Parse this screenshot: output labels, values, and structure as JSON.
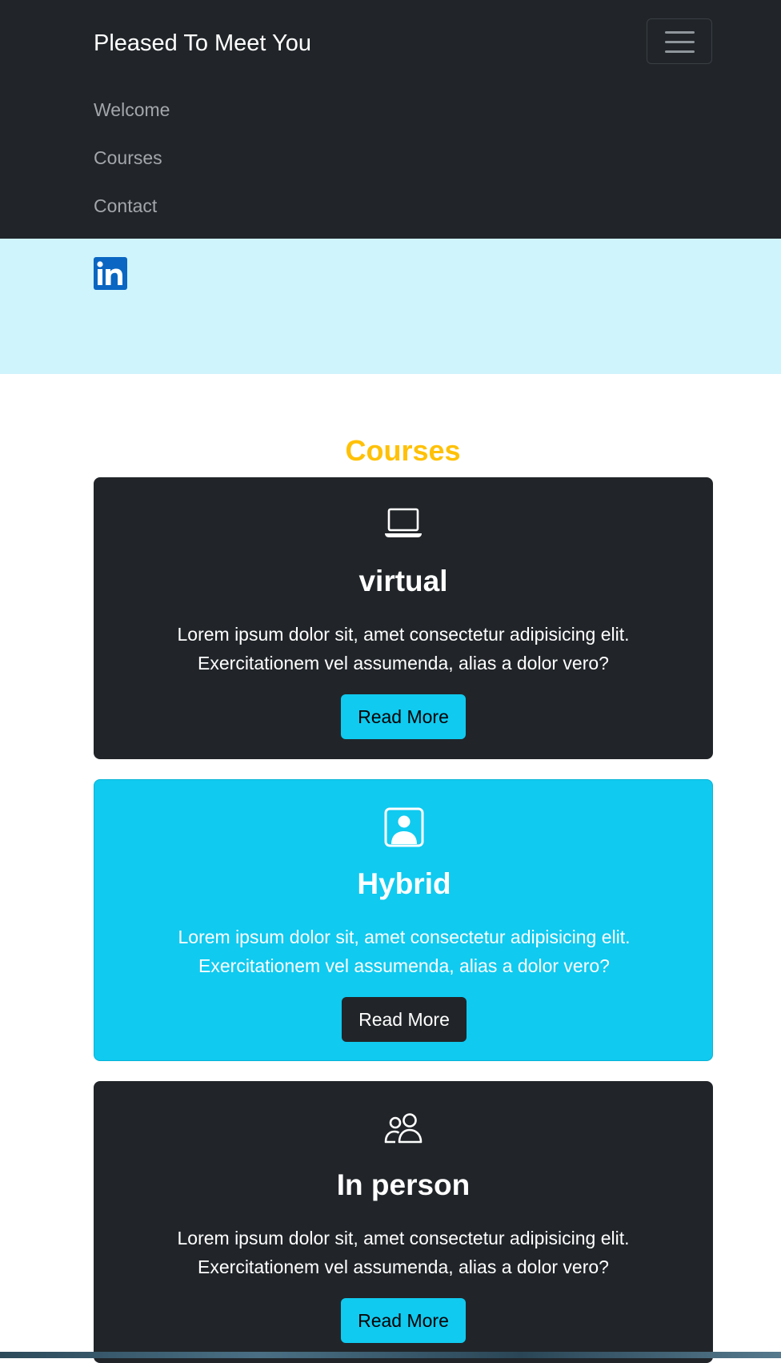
{
  "navbar": {
    "brand": "Pleased To Meet You",
    "links": [
      "Welcome",
      "Courses",
      "Contact"
    ],
    "toggler_icon": "hamburger-icon"
  },
  "banner": {
    "social_icon": "linkedin-icon"
  },
  "courses": {
    "title": "Courses",
    "cards": [
      {
        "icon": "laptop-icon",
        "title": "virtual",
        "text": "Lorem ipsum dolor sit, amet consectetur adipisicing elit. Exercitationem vel assumenda, alias a dolor vero?",
        "button": "Read More"
      },
      {
        "icon": "person-square-icon",
        "title": "Hybrid",
        "text": "Lorem ipsum dolor sit, amet consectetur adipisicing elit. Exercitationem vel assumenda, alias a dolor vero?",
        "button": "Read More"
      },
      {
        "icon": "people-icon",
        "title": "In person",
        "text": "Lorem ipsum dolor sit, amet consectetur adipisicing elit. Exercitationem vel assumenda, alias a dolor vero?",
        "button": "Read More"
      }
    ]
  },
  "colors": {
    "navbar_bg": "#212529",
    "banner_bg": "#cff4fc",
    "heading": "#ffc107",
    "info": "#10caf0",
    "linkedin": "#0a66c2"
  }
}
